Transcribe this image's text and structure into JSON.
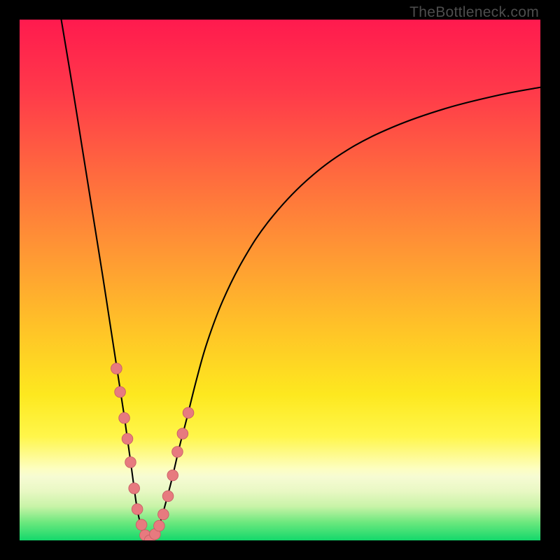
{
  "watermark": "TheBottleneck.com",
  "colors": {
    "frame": "#000000",
    "gradient_stops": [
      {
        "offset": 0.0,
        "color": "#ff1a4e"
      },
      {
        "offset": 0.14,
        "color": "#ff3a4a"
      },
      {
        "offset": 0.3,
        "color": "#ff6b3e"
      },
      {
        "offset": 0.46,
        "color": "#ff9b33"
      },
      {
        "offset": 0.6,
        "color": "#ffc527"
      },
      {
        "offset": 0.72,
        "color": "#fde81f"
      },
      {
        "offset": 0.8,
        "color": "#fff64a"
      },
      {
        "offset": 0.862,
        "color": "#fdfec0"
      },
      {
        "offset": 0.878,
        "color": "#f6fbd3"
      },
      {
        "offset": 0.905,
        "color": "#e9f8c4"
      },
      {
        "offset": 0.935,
        "color": "#c8f3a7"
      },
      {
        "offset": 0.965,
        "color": "#6de87e"
      },
      {
        "offset": 1.0,
        "color": "#13d86b"
      }
    ],
    "curve": "#000000",
    "marker_fill": "#e77a7f",
    "marker_stroke": "#c85f66"
  },
  "chart_data": {
    "type": "line",
    "title": "",
    "xlabel": "",
    "ylabel": "",
    "xlim": [
      0,
      100
    ],
    "ylim": [
      0,
      100
    ],
    "series": [
      {
        "name": "left-branch",
        "x": [
          8,
          10,
          12,
          14,
          16,
          17,
          18,
          19,
          20,
          20.7,
          21.4,
          22,
          22.5,
          23,
          23.6,
          24.3,
          25
        ],
        "y": [
          100,
          88,
          75.5,
          63,
          50.5,
          44,
          37.5,
          31,
          24.5,
          19.5,
          14.5,
          10,
          6.5,
          4,
          2,
          0.7,
          0
        ]
      },
      {
        "name": "right-branch",
        "x": [
          25,
          26,
          27,
          28,
          29.3,
          30.7,
          32,
          34,
          36,
          39,
          43,
          48,
          55,
          63,
          72,
          82,
          92,
          100
        ],
        "y": [
          0,
          1.2,
          3.5,
          7,
          12,
          18,
          23,
          31,
          38,
          46,
          54,
          61.5,
          69,
          75,
          79.5,
          83,
          85.5,
          87
        ]
      }
    ],
    "markers": {
      "name": "highlighted-points",
      "x": [
        18.6,
        19.3,
        20.1,
        20.7,
        21.3,
        22.0,
        22.6,
        23.4,
        24.1,
        25.0,
        26.0,
        26.8,
        27.6,
        28.5,
        29.4,
        30.3,
        31.3,
        32.4
      ],
      "y": [
        33.0,
        28.5,
        23.5,
        19.5,
        15.0,
        10.0,
        6.0,
        3.0,
        1.0,
        0.0,
        1.2,
        2.8,
        5.0,
        8.5,
        12.5,
        17.0,
        20.5,
        24.5
      ]
    }
  }
}
